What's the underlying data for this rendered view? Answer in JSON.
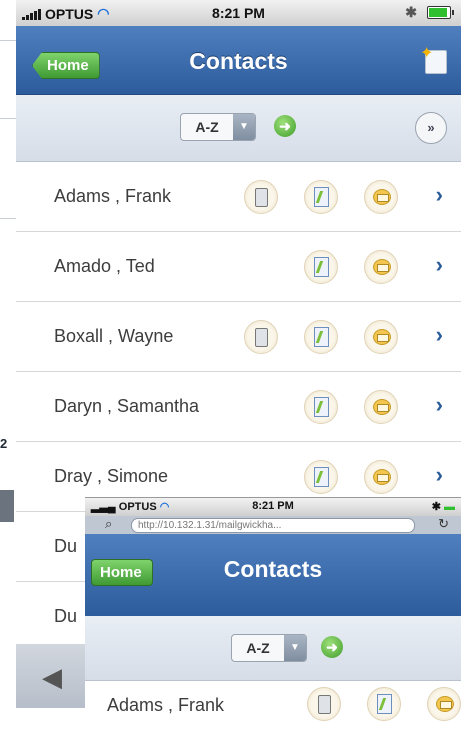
{
  "background": {
    "fragment_number": "2"
  },
  "statusbar": {
    "carrier": "OPTUS",
    "time": "8:21 PM"
  },
  "navbar": {
    "home_label": "Home",
    "title": "Contacts"
  },
  "toolbar": {
    "sort_value": "A-Z",
    "go_symbol": "➜",
    "more_symbol": "»"
  },
  "contacts": [
    {
      "name": "Adams , Frank",
      "has_mobile": true
    },
    {
      "name": "Amado , Ted",
      "has_mobile": false
    },
    {
      "name": "Boxall , Wayne",
      "has_mobile": true
    },
    {
      "name": "Daryn , Samantha",
      "has_mobile": false
    },
    {
      "name": "Dray , Simone",
      "has_mobile": false
    },
    {
      "name": "Du",
      "has_mobile": false
    },
    {
      "name": "Du",
      "has_mobile": false
    }
  ],
  "overlay": {
    "carrier": "OPTUS",
    "time": "8:21 PM",
    "url": "http://10.132.1.31/mailgwickha...",
    "home_label": "Home",
    "title": "Contacts",
    "sort_value": "A-Z",
    "first_contact": "Adams , Frank"
  },
  "icons": [
    "mobile-icon",
    "note-icon",
    "mail-icon",
    "chevron-right-icon",
    "new-contact-icon",
    "back-arrow-icon"
  ],
  "colors": {
    "navbar": "#3b6aa8",
    "home_button": "#5bb64a",
    "chevron": "#2a5c9a"
  }
}
